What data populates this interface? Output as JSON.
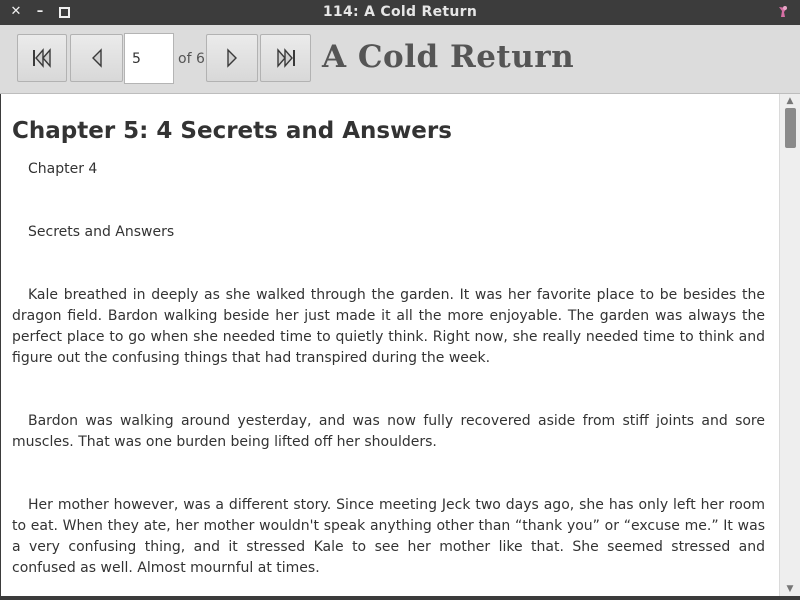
{
  "window": {
    "title": "114: A Cold Return",
    "close_glyph": "✕",
    "minimize_glyph": "–"
  },
  "toolbar": {
    "first_icon": "skip-to-first-icon",
    "prev_icon": "previous-icon",
    "next_icon": "next-icon",
    "last_icon": "skip-to-last-icon",
    "page_value": "5",
    "of_label": "of 6",
    "book_title": "A Cold Return"
  },
  "content": {
    "chapter_title": "Chapter 5: 4 Secrets and Answers",
    "paragraphs": [
      "Chapter 4",
      "Secrets and Answers",
      "Kale breathed in deeply as she walked through the garden. It was her favorite place to be besides the dragon field. Bardon walking beside her just made it all the more enjoyable. The garden was always the perfect place to go when she needed time to quietly think. Right now, she really needed time to think and figure out the confusing things that had transpired during the week.",
      "Bardon was walking around yesterday, and was now fully recovered aside from stiff joints and sore muscles. That was one burden being lifted off her shoulders.",
      "Her mother however, was a different story. Since meeting Jeck two days ago, she has only left her room to eat. When they ate, her mother wouldn't speak anything other than “thank you” or “excuse me.” It was a very confusing thing, and it stressed Kale to see her mother like that. She seemed stressed and confused as well. Almost mournful at times."
    ]
  },
  "colors": {
    "titlebar": "#3c3c3c",
    "toolbar": "#dcdcdc",
    "text": "#333333",
    "app_icon": "#d66fa4"
  }
}
